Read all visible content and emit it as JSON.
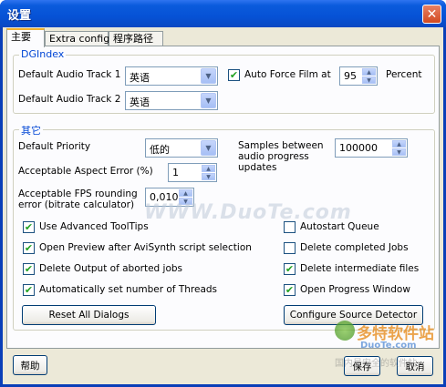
{
  "window": {
    "title": "设置",
    "close_glyph": "✕"
  },
  "tabs": [
    {
      "label": "主要",
      "active": true
    },
    {
      "label": "Extra config",
      "active": false
    },
    {
      "label": "程序路径",
      "active": false
    }
  ],
  "dgindex": {
    "legend": "DGIndex",
    "audio_track_1_label": "Default Audio Track 1",
    "audio_track_1_value": "英语",
    "audio_track_2_label": "Default Audio Track 2",
    "audio_track_2_value": "英语",
    "auto_force_film_label": "Auto Force Film at",
    "auto_force_film_checked": true,
    "auto_force_film_value": "95",
    "percent_label": "Percent"
  },
  "other": {
    "legend": "其它",
    "default_priority_label": "Default Priority",
    "default_priority_value": "低的",
    "samples_label": "Samples between audio progress updates",
    "samples_value": "100000",
    "aspect_error_label": "Acceptable Aspect Error (%)",
    "aspect_error_value": "1",
    "fps_rounding_label": "Acceptable FPS rounding error (bitrate calculator)",
    "fps_rounding_value": "0,010",
    "checkboxes_left": [
      {
        "label": "Use Advanced ToolTips",
        "checked": true
      },
      {
        "label": "Open Preview after AviSynth script selection",
        "checked": true
      },
      {
        "label": "Delete Output of aborted jobs",
        "checked": true
      },
      {
        "label": "Automatically set number of Threads",
        "checked": true
      }
    ],
    "checkboxes_right": [
      {
        "label": "Autostart Queue",
        "checked": false
      },
      {
        "label": "Delete completed Jobs",
        "checked": false
      },
      {
        "label": "Delete intermediate files",
        "checked": true
      },
      {
        "label": "Open Progress Window",
        "checked": true
      }
    ],
    "reset_button": "Reset All Dialogs",
    "configure_button": "Configure Source Detector"
  },
  "footer": {
    "help_button": "帮助",
    "save_button": "保存",
    "cancel_button": "取消"
  },
  "watermark": {
    "center_text": "WWW.DuoTe.com",
    "brand_cn": "多特软件站",
    "brand_en": "DuoTe.com",
    "brand_sub": "国内最安全的软件站"
  },
  "icons": {
    "check": "✔",
    "dropdown": "▼",
    "spin_up": "▲",
    "spin_down": "▼"
  }
}
